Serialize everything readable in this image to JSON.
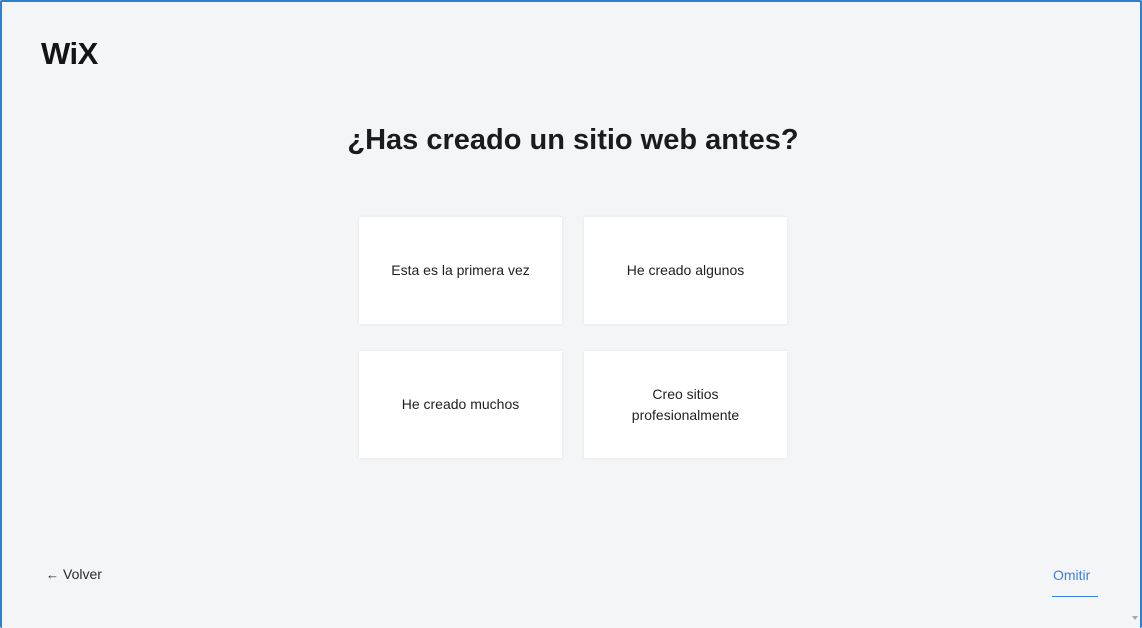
{
  "brand": {
    "logo_text": "WiX"
  },
  "main": {
    "question": "¿Has creado un sitio web antes?",
    "options": [
      {
        "label": "Esta es la primera vez"
      },
      {
        "label": "He creado algunos"
      },
      {
        "label": "He creado muchos"
      },
      {
        "label": "Creo sitios profesionalmente"
      }
    ]
  },
  "footer": {
    "back_icon": "←",
    "back_label": "Volver",
    "skip_label": "Omitir"
  },
  "colors": {
    "frame_border": "#2f7fcf",
    "background": "#f4f5f7",
    "card": "#ffffff",
    "link": "#3b82e0"
  }
}
